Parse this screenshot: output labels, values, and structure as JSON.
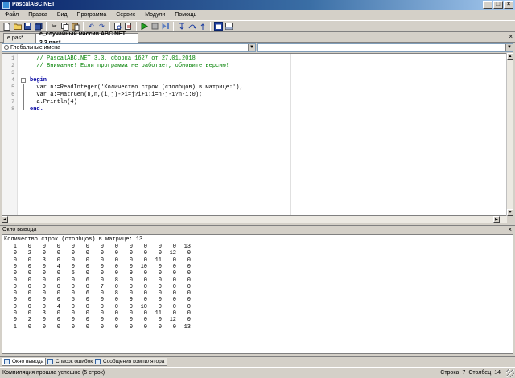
{
  "window": {
    "title": "PascalABC.NET"
  },
  "menu": [
    "Файл",
    "Правка",
    "Вид",
    "Программа",
    "Сервис",
    "Модули",
    "Помощь"
  ],
  "toolbar_icons": [
    "new-file-icon",
    "open-folder-icon",
    "save-icon",
    "save-all-icon",
    "cut-icon",
    "copy-icon",
    "paste-icon",
    "undo-icon",
    "redo-icon",
    "find-icon",
    "replace-icon",
    "run-icon",
    "stop-icon",
    "debug-icon",
    "step-into-icon",
    "step-over-icon",
    "output-window-icon",
    "toggle-panel-icon"
  ],
  "tabs": [
    {
      "label": "e.pas*",
      "active": false
    },
    {
      "label": "e_случайный массив ABC.NET 3.3.pas*",
      "active": true
    }
  ],
  "scope_combo": "Глобальные имена",
  "editor": {
    "lines": [
      {
        "num": "1",
        "text": "  // PascalABC.NET 3.3, сборка 1627 от 27.01.2018",
        "cls": "comment"
      },
      {
        "num": "2",
        "text": "  // Внимание! Если программа не работает, обновите версию!",
        "cls": "comment"
      },
      {
        "num": "3",
        "text": "",
        "cls": ""
      },
      {
        "num": "4",
        "text": "begin",
        "cls": "kw"
      },
      {
        "num": "5",
        "text": "  var n:=ReadInteger('Количество строк (столбцов) в матрице:');",
        "cls": ""
      },
      {
        "num": "6",
        "text": "  var a:=MatrGen(n,n,(i,j)->i=j?i+1:i=n-j-1?n-i:0);",
        "cls": ""
      },
      {
        "num": "7",
        "text": "  a.Println(4)",
        "cls": ""
      },
      {
        "num": "8",
        "text": "end.",
        "cls": "kw"
      }
    ]
  },
  "output": {
    "header": "Окно вывода",
    "prompt": "Количество строк (столбцов) в матрице: 13",
    "matrix": [
      [
        1,
        0,
        0,
        0,
        0,
        0,
        0,
        0,
        0,
        0,
        0,
        0,
        13
      ],
      [
        0,
        2,
        0,
        0,
        0,
        0,
        0,
        0,
        0,
        0,
        0,
        12,
        0
      ],
      [
        0,
        0,
        3,
        0,
        0,
        0,
        0,
        0,
        0,
        0,
        11,
        0,
        0
      ],
      [
        0,
        0,
        0,
        4,
        0,
        0,
        0,
        0,
        0,
        10,
        0,
        0,
        0
      ],
      [
        0,
        0,
        0,
        0,
        5,
        0,
        0,
        0,
        9,
        0,
        0,
        0,
        0
      ],
      [
        0,
        0,
        0,
        0,
        0,
        6,
        0,
        8,
        0,
        0,
        0,
        0,
        0
      ],
      [
        0,
        0,
        0,
        0,
        0,
        0,
        7,
        0,
        0,
        0,
        0,
        0,
        0
      ],
      [
        0,
        0,
        0,
        0,
        0,
        6,
        0,
        8,
        0,
        0,
        0,
        0,
        0
      ],
      [
        0,
        0,
        0,
        0,
        5,
        0,
        0,
        0,
        9,
        0,
        0,
        0,
        0
      ],
      [
        0,
        0,
        0,
        4,
        0,
        0,
        0,
        0,
        0,
        10,
        0,
        0,
        0
      ],
      [
        0,
        0,
        3,
        0,
        0,
        0,
        0,
        0,
        0,
        0,
        11,
        0,
        0
      ],
      [
        0,
        2,
        0,
        0,
        0,
        0,
        0,
        0,
        0,
        0,
        0,
        12,
        0
      ],
      [
        1,
        0,
        0,
        0,
        0,
        0,
        0,
        0,
        0,
        0,
        0,
        0,
        13
      ]
    ]
  },
  "bottom_tabs": [
    "Окно вывода",
    "Список ошибок",
    "Сообщения компилятора"
  ],
  "status": {
    "message": "Компиляция прошла успешно (5 строк)",
    "row_label": "Строка",
    "row": "7",
    "col_label": "Столбец",
    "col": "14"
  }
}
